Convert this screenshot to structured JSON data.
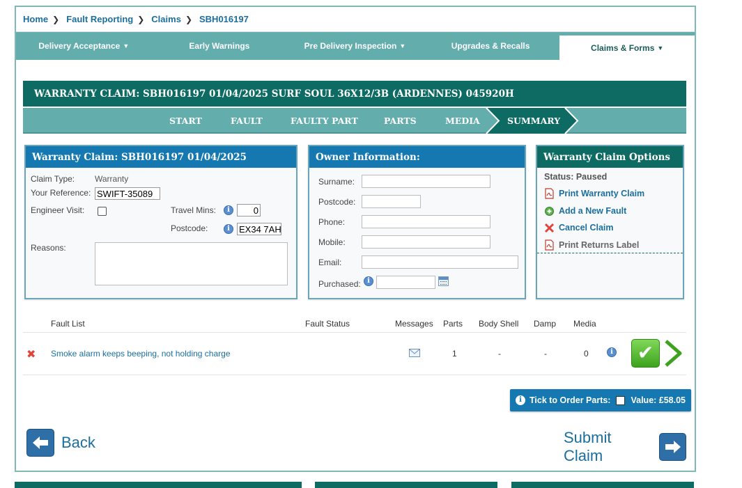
{
  "breadcrumb": [
    {
      "label": "Home"
    },
    {
      "label": "Fault Reporting"
    },
    {
      "label": "Claims"
    },
    {
      "label": "SBH016197"
    }
  ],
  "nav": {
    "delivery_acceptance": "Delivery Acceptance",
    "early_warnings": "Early Warnings",
    "pre_delivery_inspection": "Pre Delivery Inspection",
    "upgrades_recalls": "Upgrades & Recalls",
    "claims_forms": "Claims & Forms"
  },
  "claim_header": "WARRANTY CLAIM: SBH016197 01/04/2025 SURF SOUL 36X12/3B (ARDENNES) 045920H",
  "steps": {
    "start": "START",
    "fault": "FAULT",
    "faulty_part": "FAULTY PART",
    "parts": "PARTS",
    "media": "MEDIA",
    "summary": "SUMMARY"
  },
  "claim_panel": {
    "title": "Warranty Claim: SBH016197 01/04/2025",
    "claim_type_label": "Claim Type:",
    "claim_type_value": "Warranty",
    "your_reference_label": "Your Reference:",
    "your_reference_value": "SWIFT-35089",
    "engineer_visit_label": "Engineer Visit:",
    "engineer_visit_checked": false,
    "travel_mins_label": "Travel Mins:",
    "travel_mins_value": "0",
    "postcode_label": "Postcode:",
    "postcode_value": "EX34 7AH",
    "reasons_label": "Reasons:",
    "reasons_value": ""
  },
  "owner_panel": {
    "title": "Owner Information:",
    "surname_label": "Surname:",
    "postcode_label": "Postcode:",
    "phone_label": "Phone:",
    "mobile_label": "Mobile:",
    "email_label": "Email:",
    "purchased_label": "Purchased:"
  },
  "options_panel": {
    "title": "Warranty Claim Options",
    "status": "Status: Paused",
    "print_warranty_claim": "Print Warranty Claim",
    "add_new_fault": "Add a New Fault",
    "cancel_claim": "Cancel Claim",
    "print_returns_label": "Print Returns Label"
  },
  "fault_table": {
    "headers": {
      "fault_list": "Fault List",
      "fault_status": "Fault Status",
      "messages": "Messages",
      "parts": "Parts",
      "body_shell": "Body Shell",
      "damp": "Damp",
      "media": "Media"
    },
    "rows": [
      {
        "description": "Smoke alarm keeps beeping, not holding charge",
        "fault_status": "",
        "parts": "1",
        "body_shell": "-",
        "damp": "-",
        "media": "0"
      }
    ]
  },
  "order_parts": {
    "label": "Tick to Order Parts:",
    "checked": false,
    "value": "Value: £58.05"
  },
  "buttons": {
    "back": "Back",
    "submit": "Submit Claim"
  },
  "colors": {
    "teal_dark": "#0e6b63",
    "teal_light": "#63adad",
    "blue": "#1578b0",
    "link": "#1b6f9f"
  }
}
